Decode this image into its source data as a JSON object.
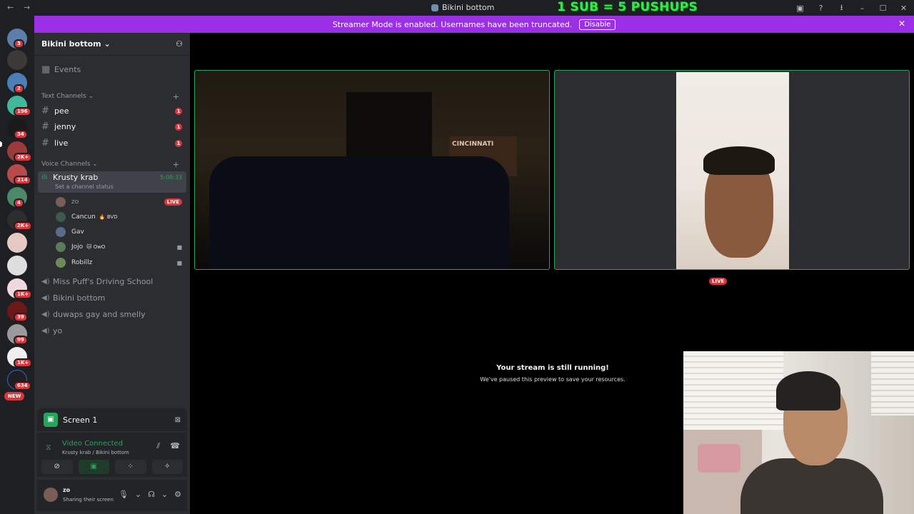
{
  "titlebar": {
    "back": "←",
    "forward": "→",
    "title": "Bikini bottom",
    "overlay": "1 SUB = 5 PUSHUPS",
    "icons": [
      "inbox-icon",
      "help-icon",
      "download-icon",
      "minimize-icon",
      "maximize-icon",
      "close-icon"
    ]
  },
  "banner": {
    "text": "Streamer Mode is enabled. Usernames have been truncated.",
    "button": "Disable"
  },
  "guilds": {
    "badges": [
      "3",
      "2",
      "196",
      "34",
      "2K+",
      "214",
      "4",
      "2K+",
      "1K+",
      "39",
      "99",
      "1K+",
      "634"
    ],
    "new_label": "NEW"
  },
  "server": {
    "name": "Bikini bottom",
    "events_label": "Events",
    "text_category": "Text Channels",
    "text_channels": [
      {
        "name": "pee",
        "unread": "1"
      },
      {
        "name": "jenny",
        "unread": "1"
      },
      {
        "name": "live",
        "unread": "1"
      }
    ],
    "voice_category": "Voice Channels",
    "active_voice": {
      "name": "Krusty krab",
      "time": "5:08:33",
      "status": "Set a channel status"
    },
    "members": [
      {
        "name": "zo",
        "tag": "",
        "live": "LIVE"
      },
      {
        "name": "Cancun",
        "tag": "🔥 BVD"
      },
      {
        "name": "Gav",
        "tag": ""
      },
      {
        "name": "Jojo",
        "tag": "🐱 OwO"
      },
      {
        "name": "Robillz",
        "tag": ""
      }
    ],
    "voice_channels": [
      "Miss Puff's Driving School",
      "Bikini bottom",
      "duwaps gay and smelly",
      "yo"
    ]
  },
  "screen_panel": {
    "label": "Screen 1"
  },
  "voice_panel": {
    "status": "Video Connected",
    "sub": "Krusty krab / Bikini bottom"
  },
  "user": {
    "name": "zo",
    "status": "Sharing their screen"
  },
  "stage": {
    "tile1_flag": "CINCINNATI",
    "live_label": "LIVE",
    "paused_title": "Your stream is still running!",
    "paused_sub": "We've paused this preview to save your resources."
  },
  "colors": {
    "accent_green": "#23a55a",
    "banner_purple": "#9b2fe6",
    "badge_red": "#da373c"
  }
}
